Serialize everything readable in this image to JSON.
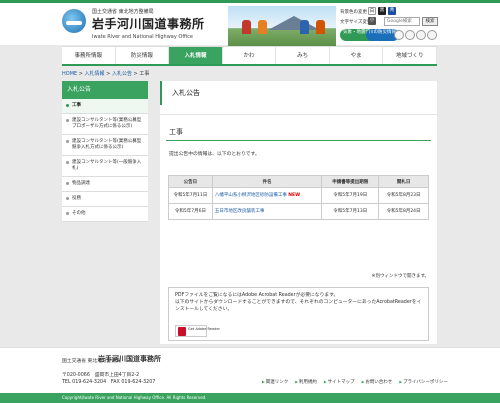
{
  "header": {
    "org_small": "国土交通省 東北地方整備局",
    "org_name": "岩手河川国道事務所",
    "org_en": "Iwate River and National Highway Office",
    "util": {
      "page_color": "背景色の変更",
      "font_size": "文字サイズ変更",
      "color_btns": [
        "白",
        "黒",
        "青"
      ],
      "size_btns": [
        "小",
        "中",
        "大"
      ],
      "search_placeholder": "Google検索",
      "search_button": "検索",
      "pill_label": "気象・地震情報",
      "pill_label2": "川の防災情報"
    }
  },
  "nav": {
    "items": [
      "事務所情報",
      "防災情報",
      "入札情報",
      "かわ",
      "みち",
      "やま",
      "地域づくり"
    ],
    "active_index": 2
  },
  "breadcrumb": {
    "items": [
      "HOME",
      "入札情報",
      "入札公告",
      "工事"
    ],
    "separator": " > "
  },
  "sidebar": {
    "title": "入札公告",
    "items": [
      "工事",
      "建設コンサルタント等(業務公募型プロポーザル方式に係る公示)",
      "建設コンサルタント等(業務公募型競争入札方式に係る公示)",
      "建設コンサルタント等(一般競争入札)",
      "物品調達",
      "役務",
      "その他"
    ]
  },
  "main": {
    "page_title": "入札公告",
    "section_title": "工事",
    "intro": "提出公告中の情報は、以下のとおりです。",
    "table": {
      "headers": [
        "公告日",
        "件名",
        "申請書等提出期限",
        "開札日"
      ],
      "rows": [
        {
          "date": "令和5年7月11日",
          "name": "八幡平山系小柳沢地区砂防設備工事",
          "new": "NEW",
          "deadline": "令和5年7月19日",
          "opening": "令和5年8月23日"
        },
        {
          "date": "令和5年7月6日",
          "name": "五日市地区改良舗装工事",
          "new": "",
          "deadline": "令和5年7月13日",
          "opening": "令和5年8月24日"
        }
      ]
    },
    "window_note": "※別ウィンドウで開きます。",
    "pdf_notice": "PDFファイルをご覧になるにはAdobe Acrobat Readerが必要になります。",
    "pdf_notice2": "以下のサイトからダウンロードすることができますので、それぞれのコンピューターにあったAcrobatReaderをインストールしてください。",
    "reader_badge": "Get Adobe Reader"
  },
  "footer": {
    "org_small": "国土交通省 東北地方整備局",
    "org_name": "岩手河川国道事務所",
    "address": "〒020-0066　盛岡市上田4丁目2-2",
    "tel": "TEL 019-624-3204　FAX 019-624-3207",
    "links": [
      "関連リンク",
      "利用規約",
      "サイトマップ",
      "お問い合わせ",
      "プライバシーポリシー"
    ],
    "copyright": "Copyright(Iwate River and National Highway Office. All Rights Reserved."
  },
  "colors": {
    "accent": "#3aa35f",
    "link": "#1a5ca8",
    "new": "#dd0000"
  }
}
